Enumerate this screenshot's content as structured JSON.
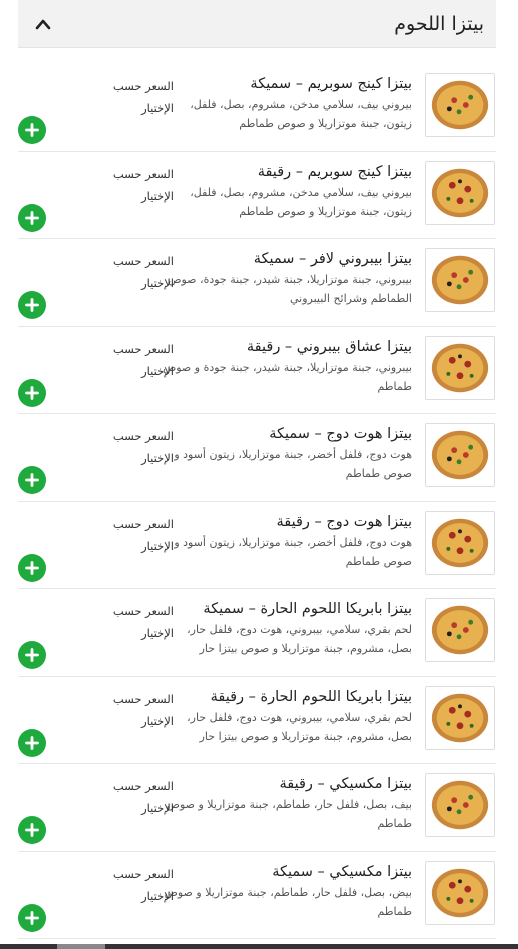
{
  "category": {
    "title": "بيتزا اللحوم",
    "toggle_icon": "chevron-up-icon"
  },
  "colors": {
    "add_button": "#1eaa3c",
    "header_bg": "#f2f2f2"
  },
  "items": [
    {
      "name": "بيتزا كينج سوبريم – سميكة",
      "description": "بيروني بيف، سلامي مدخن، مشروم، بصل، فلفل، زيتون، جبنة موتزاريلا و صوص طماطم",
      "price_label": "السعر حسب الإختيار",
      "image": "pizza-icon",
      "add_icon": "plus-icon"
    },
    {
      "name": "بيتزا كينج سوبريم – رقيقة",
      "description": "بيروني بيف، سلامي مدخن، مشروم، بصل، فلفل، زيتون، جبنة موتزاريلا و صوص طماطم",
      "price_label": "السعر حسب الإختيار",
      "image": "pizza-icon",
      "add_icon": "plus-icon"
    },
    {
      "name": "بيتزا بيبروني لافر – سميكة",
      "description": "بيبروني، جبنة موتزاريلا، جبنة شيدر، جبنة جودة، صوص الطماطم وشرائح البيبروني",
      "price_label": "السعر حسب الإختيار",
      "image": "pizza-icon",
      "add_icon": "plus-icon"
    },
    {
      "name": "بيتزا عشاق بيبروني – رقيقة",
      "description": "بيبروني، جبنة موتزاريلا، جبنة شيدر، جبنة جودة و صوص طماطم",
      "price_label": "السعر حسب الإختيار",
      "image": "pizza-icon",
      "add_icon": "plus-icon"
    },
    {
      "name": "بيتزا هوت دوج – سميكة",
      "description": "هوت دوج، فلفل أخضر، جبنة موتزاريلا، زيتون أسود و صوص طماطم",
      "price_label": "السعر حسب الإختيار",
      "image": "pizza-icon",
      "add_icon": "plus-icon"
    },
    {
      "name": "بيتزا هوت دوج – رقيقة",
      "description": "هوت دوج، فلفل أخضر، جبنة موتزاريلا، زيتون أسود و صوص طماطم",
      "price_label": "السعر حسب الإختيار",
      "image": "pizza-icon",
      "add_icon": "plus-icon"
    },
    {
      "name": "بيتزا بابريكا اللحوم الحارة – سميكة",
      "description": "لحم بقري، سلامي، بيبروني، هوت دوج، فلفل حار، بصل، مشروم، جبنة موتزاريلا و صوص بيتزا حار",
      "price_label": "السعر حسب الإختيار",
      "image": "pizza-icon",
      "add_icon": "plus-icon"
    },
    {
      "name": "بيتزا بابريكا اللحوم الحارة – رقيقة",
      "description": "لحم بقري، سلامي، بيبروني، هوت دوج، فلفل حار، بصل، مشروم، جبنة موتزاريلا و صوص بيتزا حار",
      "price_label": "السعر حسب الإختيار",
      "image": "pizza-icon",
      "add_icon": "plus-icon"
    },
    {
      "name": "بيتزا مكسيكي – رقيقة",
      "description": "بيف، بصل، فلفل حار، طماطم، جبنة موتزاريلا و صوص طماطم",
      "price_label": "السعر حسب الإختيار",
      "image": "pizza-icon",
      "add_icon": "plus-icon"
    },
    {
      "name": "بيتزا مكسيكي – سميكة",
      "description": "بيض، بصل، فلفل حار، طماطم، جبنة موتزاريلا و صوص طماطم",
      "price_label": "السعر حسب الإختيار",
      "image": "pizza-icon",
      "add_icon": "plus-icon"
    }
  ]
}
